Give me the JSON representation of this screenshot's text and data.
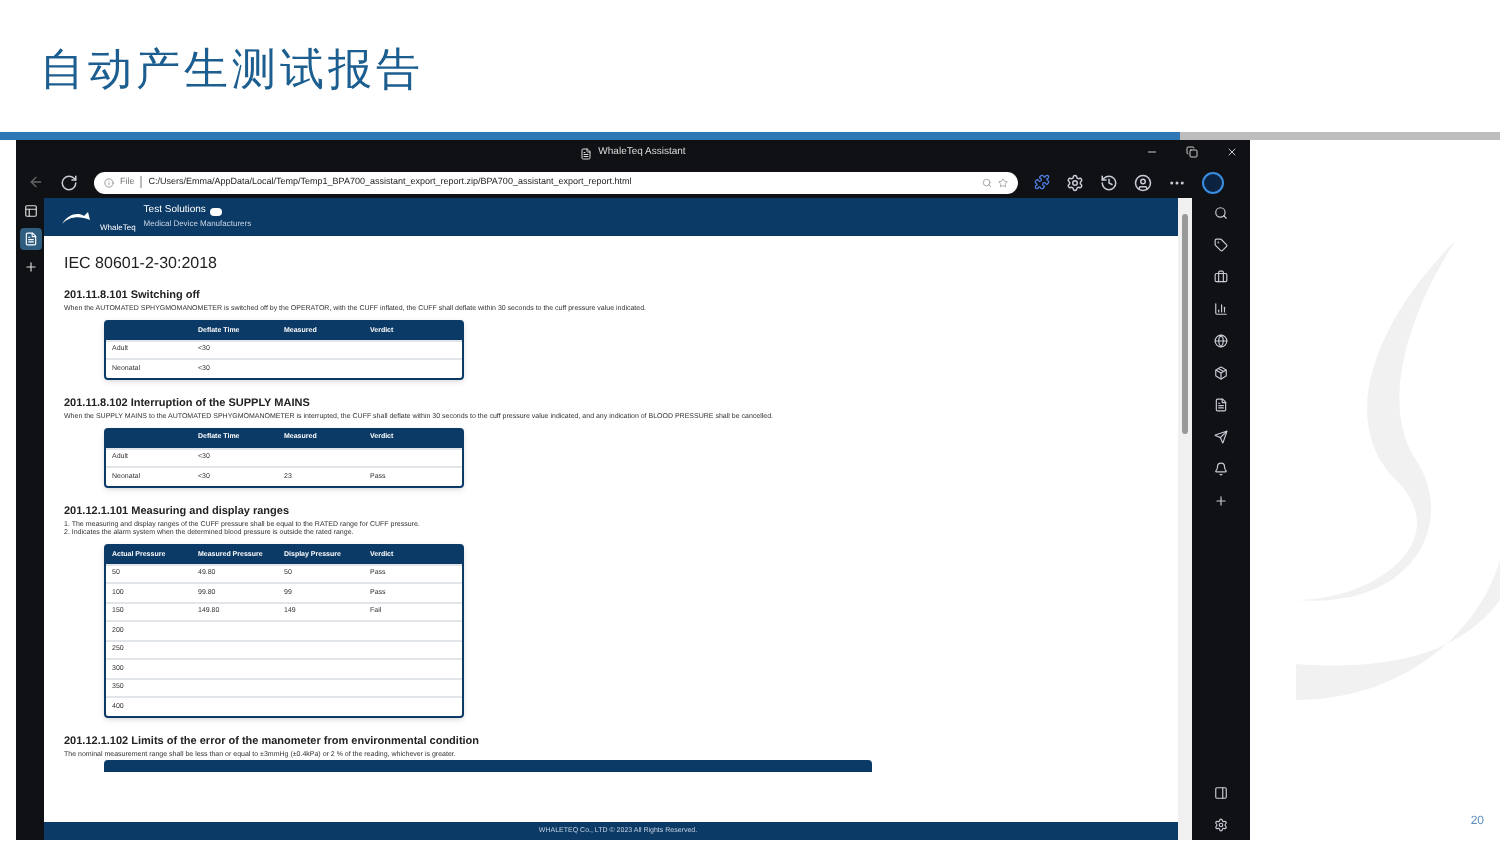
{
  "slide": {
    "title": "自动产生测试报告",
    "page_number": "20"
  },
  "browser": {
    "window_title": "WhaleTeq Assistant",
    "address_label": "File",
    "url": "C:/Users/Emma/AppData/Local/Temp/Temp1_BPA700_assistant_export_report.zip/BPA700_assistant_export_report.html"
  },
  "report": {
    "brand": "Test Solutions",
    "brand_tagline": "Medical Device Manufacturers",
    "logo_text": "WhaleTeq",
    "standard": "IEC 80601-2-30:2018",
    "sections": [
      {
        "heading": "201.11.8.101 Switching off",
        "notes": [
          "When the AUTOMATED SPHYGMOMANOMETER is switched off by the OPERATOR, with the CUFF inflated, the CUFF shall deflate within 30 seconds to the cuff pressure value indicated."
        ],
        "table": {
          "columns": [
            "",
            "Deflate Time",
            "Measured",
            "Verdict"
          ],
          "rows": [
            [
              "Adult",
              "<30",
              "",
              ""
            ],
            [
              "Neonatal",
              "<30",
              "",
              ""
            ]
          ]
        }
      },
      {
        "heading": "201.11.8.102 Interruption of the SUPPLY MAINS",
        "notes": [
          "When the SUPPLY MAINS to the AUTOMATED SPHYGMOMANOMETER is interrupted, the CUFF shall deflate within 30 seconds to the cuff pressure value indicated, and any indication of BLOOD PRESSURE shall be cancelled."
        ],
        "table": {
          "columns": [
            "",
            "Deflate Time",
            "Measured",
            "Verdict"
          ],
          "rows": [
            [
              "Adult",
              "<30",
              "",
              ""
            ],
            [
              "Neonatal",
              "<30",
              "23",
              "Pass"
            ]
          ]
        }
      },
      {
        "heading": "201.12.1.101 Measuring and display ranges",
        "notes": [
          "1. The measuring and display ranges of the CUFF pressure shall be equal to the RATED range for CUFF pressure.",
          "2. Indicates the alarm system when the determined blood pressure is outside the rated range."
        ],
        "table": {
          "columns": [
            "Actual Pressure",
            "Measured Pressure",
            "Display Pressure",
            "Verdict"
          ],
          "rows": [
            [
              "50",
              "49.80",
              "50",
              "Pass"
            ],
            [
              "100",
              "99.80",
              "99",
              "Pass"
            ],
            [
              "150",
              "149.80",
              "149",
              "Fail"
            ],
            [
              "200",
              "",
              "",
              ""
            ],
            [
              "250",
              "",
              "",
              ""
            ],
            [
              "300",
              "",
              "",
              ""
            ],
            [
              "350",
              "",
              "",
              ""
            ],
            [
              "400",
              "",
              "",
              ""
            ]
          ]
        }
      },
      {
        "heading": "201.12.1.102 Limits of the error of the manometer from environmental condition",
        "notes": [
          "The nominal measurement range shall be less than or equal to ±3mmHg (±0.4kPa) or 2 % of the reading, whichever is greater."
        ],
        "table": {
          "kind": "cut"
        }
      }
    ],
    "footer": "WHALETEQ Co., LTD © 2023 All Rights Reserved."
  }
}
